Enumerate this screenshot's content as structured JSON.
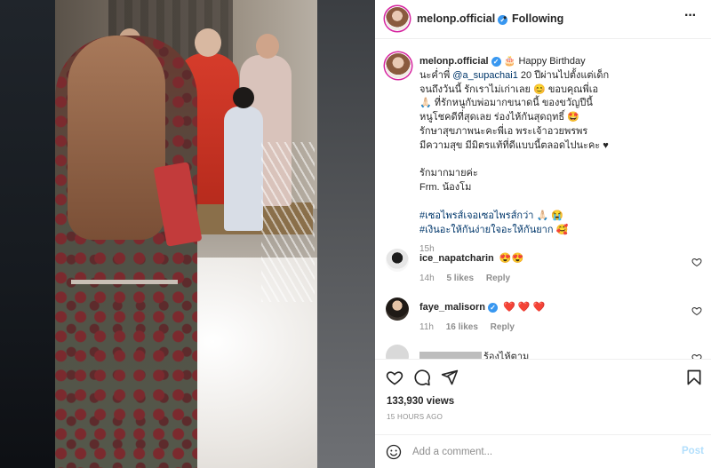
{
  "post": {
    "username": "melonp.official",
    "verified_mark": "✓",
    "dot": "•",
    "following_label": "Following",
    "more_label": "···"
  },
  "caption": {
    "username": "melonp.official",
    "lines": [
      "🎂 Happy Birthday",
      "นะค่ำพี่",
      "@a_supachai1",
      " 20 ปีผ่านไปตั้งแต่เด็ก",
      "จนถึงวันนี้ รักเราไม่เก่าเลย 😊 ขอบคุณพี่เอ",
      "🙏🏻 ที่รักหนูกับพ่อมากขนาดนี้ ของขวัญปีนี้",
      "หนูโชคดีที่สุดเลย ร่องไห้กันสุดฤทธิ์ 🤩",
      "รักษาสุขภาพนะคะพี่เอ พระเจ้าอวยพรพร",
      "มีความสุข มีมิตรแท้ที่ดีแบบนี้ตลอดไปนะคะ ♥",
      "รักมากมายค่ะ",
      "Frm. น้องโม",
      "#เซอไพรส์เจอเซอไพรส์กว่า 🙏🏻 😭",
      "#เงินอะให้กันง่ายใจอะให้กันยาก 🥰"
    ],
    "time": "15h"
  },
  "comments": [
    {
      "username": "ice_napatcharin",
      "text": "😍😍",
      "time": "14h",
      "likes": "5 likes",
      "reply": "Reply"
    },
    {
      "username": "faye_malisorn",
      "text": "❤️ ❤️ ❤️",
      "time": "11h",
      "likes": "16 likes",
      "reply": "Reply"
    },
    {
      "username": "",
      "text": "ร้องไห้ตาม",
      "time": "",
      "likes": "",
      "reply": ""
    }
  ],
  "icons": {
    "like": "heart-icon",
    "comment": "comment-icon",
    "share": "paper-plane-icon",
    "save": "bookmark-icon",
    "emoji": "smiley-icon"
  },
  "stats": {
    "views": "133,930 views",
    "posted": "15 HOURS AGO"
  },
  "add_comment": {
    "placeholder": "Add a comment...",
    "post_label": "Post"
  },
  "colors": {
    "verified": "#3897f0",
    "link": "#00376b",
    "post_disabled": "#b2dffc",
    "story_ring": "#d6249f"
  }
}
